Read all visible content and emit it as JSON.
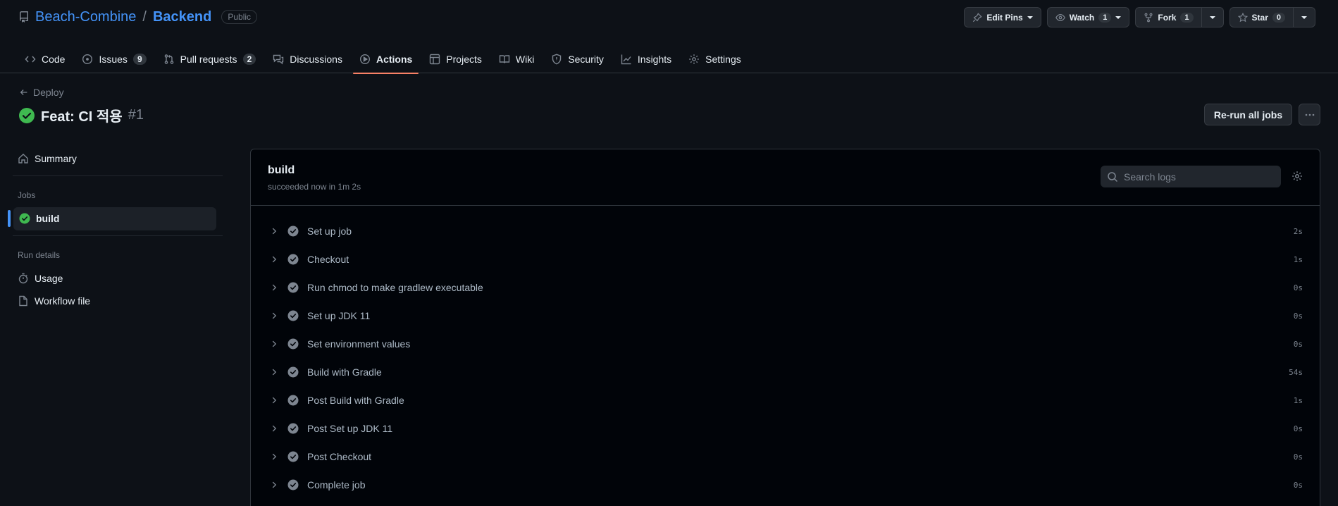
{
  "repo": {
    "owner": "Beach-Combine",
    "separator": "/",
    "name": "Backend",
    "visibility": "Public"
  },
  "header_actions": {
    "edit_pins": "Edit Pins",
    "watch": {
      "label": "Watch",
      "count": "1"
    },
    "fork": {
      "label": "Fork",
      "count": "1"
    },
    "star": {
      "label": "Star",
      "count": "0"
    }
  },
  "nav": [
    {
      "label": "Code",
      "icon": "code-icon"
    },
    {
      "label": "Issues",
      "count": "9",
      "icon": "issue-opened-icon"
    },
    {
      "label": "Pull requests",
      "count": "2",
      "icon": "git-pull-request-icon"
    },
    {
      "label": "Discussions",
      "icon": "comment-discussion-icon"
    },
    {
      "label": "Actions",
      "icon": "play-icon",
      "active": true
    },
    {
      "label": "Projects",
      "icon": "table-icon"
    },
    {
      "label": "Wiki",
      "icon": "book-icon"
    },
    {
      "label": "Security",
      "icon": "shield-icon"
    },
    {
      "label": "Insights",
      "icon": "graph-icon"
    },
    {
      "label": "Settings",
      "icon": "gear-icon"
    }
  ],
  "run": {
    "back_label": "Deploy",
    "title": "Feat: CI 적용",
    "number": "#1",
    "rerun_label": "Re-run all jobs"
  },
  "sidebar": {
    "summary": "Summary",
    "jobs_heading": "Jobs",
    "job": "build",
    "run_details_heading": "Run details",
    "usage": "Usage",
    "workflow_file": "Workflow file"
  },
  "job": {
    "name": "build",
    "status": "succeeded now in 1m 2s",
    "search_placeholder": "Search logs",
    "steps": [
      {
        "label": "Set up job",
        "duration": "2s"
      },
      {
        "label": "Checkout",
        "duration": "1s"
      },
      {
        "label": "Run chmod to make gradlew executable",
        "duration": "0s"
      },
      {
        "label": "Set up JDK 11",
        "duration": "0s"
      },
      {
        "label": "Set environment values",
        "duration": "0s"
      },
      {
        "label": "Build with Gradle",
        "duration": "54s"
      },
      {
        "label": "Post Build with Gradle",
        "duration": "1s"
      },
      {
        "label": "Post Set up JDK 11",
        "duration": "0s"
      },
      {
        "label": "Post Checkout",
        "duration": "0s"
      },
      {
        "label": "Complete job",
        "duration": "0s"
      }
    ]
  },
  "colors": {
    "success": "#3fb950",
    "accent": "#4493f8",
    "tab_underline": "#f78166",
    "step_check": "#7d8590"
  }
}
